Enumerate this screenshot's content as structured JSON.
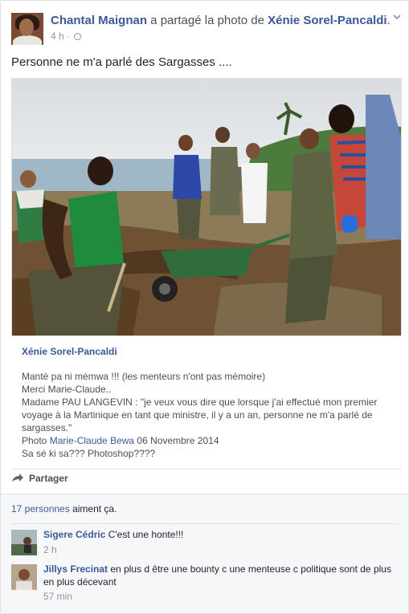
{
  "post": {
    "author": "Chantal Maignan",
    "action": " a partagé la photo de ",
    "target": "Xénie Sorel-Pancaldi",
    "target_suffix": ".",
    "time": "4 h ·",
    "text": "Personne ne m'a parlé des Sargasses ...."
  },
  "caption": {
    "author": "Xénie Sorel-Pancaldi",
    "line1": "Mantè pa ni mémwa !!! (les menteurs n'ont pas mémoire)",
    "line2": "Merci Marie-Claude..",
    "line3": "Madame PAU LANGEVIN : \"je veux vous dire que lorsque j'ai effectué mon premier",
    "line4": "voyage à la Martinique en tant que ministre, il y a un an, personne ne m'a parlé de",
    "line5": "sargasses.\"",
    "photo_prefix": "Photo ",
    "photo_credit": "Marie-Claude Bewa",
    "photo_date": " 06 Novembre 2014",
    "line7": "Sa sé ki sa??? Photoshop????"
  },
  "actions": {
    "share_label": "Partager"
  },
  "likes": {
    "count_link": "17 personnes",
    "suffix": " aiment ça."
  },
  "comments": [
    {
      "author": "Sigere Cédric",
      "text": " C'est une honte!!!",
      "time": "2 h"
    },
    {
      "author": "Jillys Frecinat",
      "text": " en plus d être une bounty c une menteuse c politique sont de plus en plus décevant",
      "time": "57 min"
    }
  ],
  "icons": {
    "globe": "globe-icon",
    "chevron": "chevron-down-icon",
    "share": "share-arrow-icon"
  },
  "colors": {
    "link": "#3b5998",
    "meta": "#90949c",
    "panel": "#f6f7f9"
  }
}
